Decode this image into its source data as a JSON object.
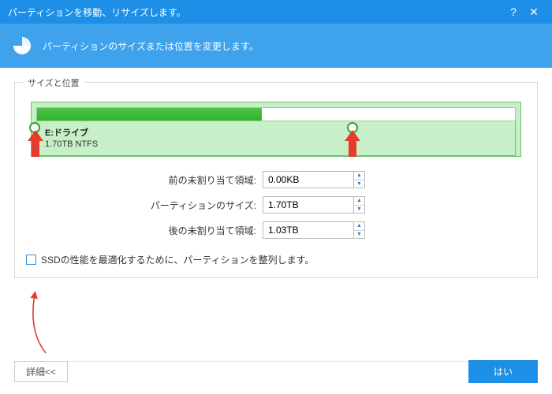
{
  "titlebar": {
    "title": "パーティションを移動、リサイズします。"
  },
  "header": {
    "subtitle": "パーティションのサイズまたは位置を変更します。"
  },
  "group": {
    "legend": "サイズと位置"
  },
  "drive": {
    "name": "E:ドライブ",
    "size_label": "1.70TB NTFS"
  },
  "fields": {
    "unalloc_before": {
      "label": "前の未割り当て領域:",
      "value": "0.00KB"
    },
    "partition_size": {
      "label": "パーティションのサイズ:",
      "value": "1.70TB"
    },
    "unalloc_after": {
      "label": "後の未割り当て領域:",
      "value": "1.03TB"
    }
  },
  "checkbox": {
    "label": "SSDの性能を最適化するために、パーティションを整列します。"
  },
  "footer": {
    "detail": "詳細<<",
    "ok": "はい"
  },
  "diagram": {
    "fill_percent": 47,
    "right_handle_percent": 64
  }
}
